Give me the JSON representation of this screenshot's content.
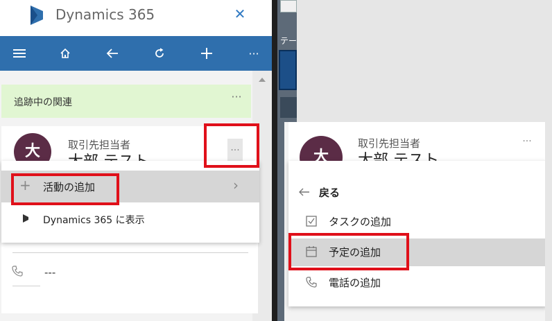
{
  "left_panel": {
    "app_title": "Dynamics 365",
    "toolbar": {
      "icons": [
        "menu-icon",
        "home-icon",
        "back-arrow-icon",
        "refresh-icon",
        "add-icon",
        "more-icon"
      ],
      "more_label": "···"
    },
    "follow_bar": {
      "label": "追跡中の関連",
      "more_label": "···"
    },
    "card": {
      "avatar_initial": "大",
      "type_label": "取引先担当者",
      "name_partial": "大部 テスト",
      "more_label": "···"
    },
    "context_menu": {
      "add_activity_label": "活動の追加",
      "show_in_d365_label": "Dynamics 365 に表示"
    },
    "phone_value": "---"
  },
  "right_panel": {
    "card": {
      "avatar_initial": "大",
      "type_label": "取引先担当者",
      "name_partial": "大部 テスト",
      "more_label": "···"
    },
    "submenu": {
      "back_label": "戻る",
      "items": [
        {
          "label": "タスクの追加",
          "icon": "checkbox-icon"
        },
        {
          "label": "予定の追加",
          "icon": "calendar-icon"
        },
        {
          "label": "電話の追加",
          "icon": "phone-icon"
        }
      ]
    }
  },
  "background_app": {
    "tab_label": "テー"
  },
  "colors": {
    "toolbar": "#2f6fad",
    "avatar": "#5b2c46",
    "follow_bar": "#e1f6d2",
    "highlight_box": "#e0101a",
    "selected_row": "#d6d6d6"
  }
}
